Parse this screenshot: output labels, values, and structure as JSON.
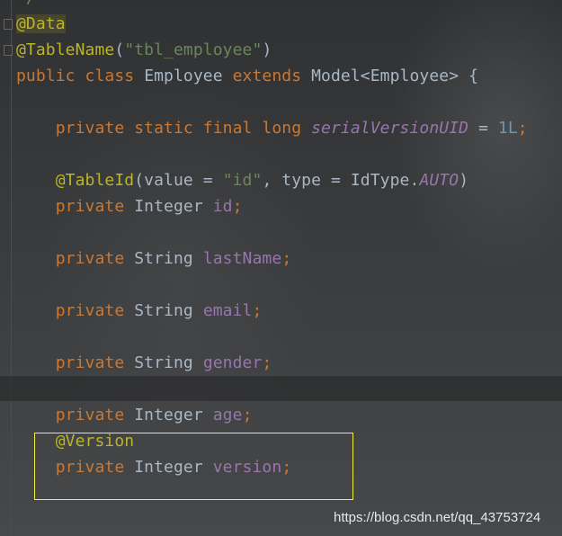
{
  "editor": {
    "lines": [
      [
        [
          "*/",
          "cm"
        ]
      ],
      [
        [
          "@Data",
          "ann data-ann"
        ]
      ],
      [
        [
          "@TableName",
          "ann"
        ],
        [
          "(",
          "plain"
        ],
        [
          "\"tbl_employee\"",
          "str"
        ],
        [
          ")",
          "plain"
        ]
      ],
      [
        [
          "public class ",
          "kw"
        ],
        [
          "Employee ",
          "plain"
        ],
        [
          "extends ",
          "kw"
        ],
        [
          "Model<Employee> {",
          "plain"
        ]
      ],
      [],
      [
        [
          "    private static final long ",
          "kw"
        ],
        [
          "serialVersionUID",
          "it"
        ],
        [
          " = ",
          "plain"
        ],
        [
          "1L",
          "num"
        ],
        [
          ";",
          "kw"
        ]
      ],
      [],
      [
        [
          "    @TableId",
          "ann"
        ],
        [
          "(value = ",
          "plain"
        ],
        [
          "\"id\"",
          "str"
        ],
        [
          ", type = IdType.",
          "plain"
        ],
        [
          "AUTO",
          "it"
        ],
        [
          ")",
          "plain"
        ]
      ],
      [
        [
          "    private ",
          "kw"
        ],
        [
          "Integer ",
          "plain"
        ],
        [
          "id",
          "field"
        ],
        [
          ";",
          "kw"
        ]
      ],
      [],
      [
        [
          "    private ",
          "kw"
        ],
        [
          "String ",
          "plain"
        ],
        [
          "lastName",
          "field"
        ],
        [
          ";",
          "kw"
        ]
      ],
      [],
      [
        [
          "    private ",
          "kw"
        ],
        [
          "String ",
          "plain"
        ],
        [
          "email",
          "field"
        ],
        [
          ";",
          "kw"
        ]
      ],
      [],
      [
        [
          "    private ",
          "kw"
        ],
        [
          "String ",
          "plain"
        ],
        [
          "gender",
          "field"
        ],
        [
          ";",
          "kw"
        ]
      ],
      [],
      [
        [
          "    private ",
          "kw"
        ],
        [
          "Integer ",
          "plain"
        ],
        [
          "age",
          "field"
        ],
        [
          ";",
          "kw"
        ]
      ],
      [
        [
          "    @Version",
          "ann"
        ]
      ],
      [
        [
          "    private ",
          "kw"
        ],
        [
          "Integer ",
          "plain"
        ],
        [
          "version",
          "field"
        ],
        [
          ";",
          "kw"
        ]
      ]
    ]
  },
  "watermark": "https://blog.csdn.net/qq_43753724",
  "colors": {
    "keyword": "#cc7832",
    "annotation": "#bbb529",
    "string": "#6a8759",
    "field": "#9876aa",
    "highlight_box": "#f2ee3a"
  }
}
